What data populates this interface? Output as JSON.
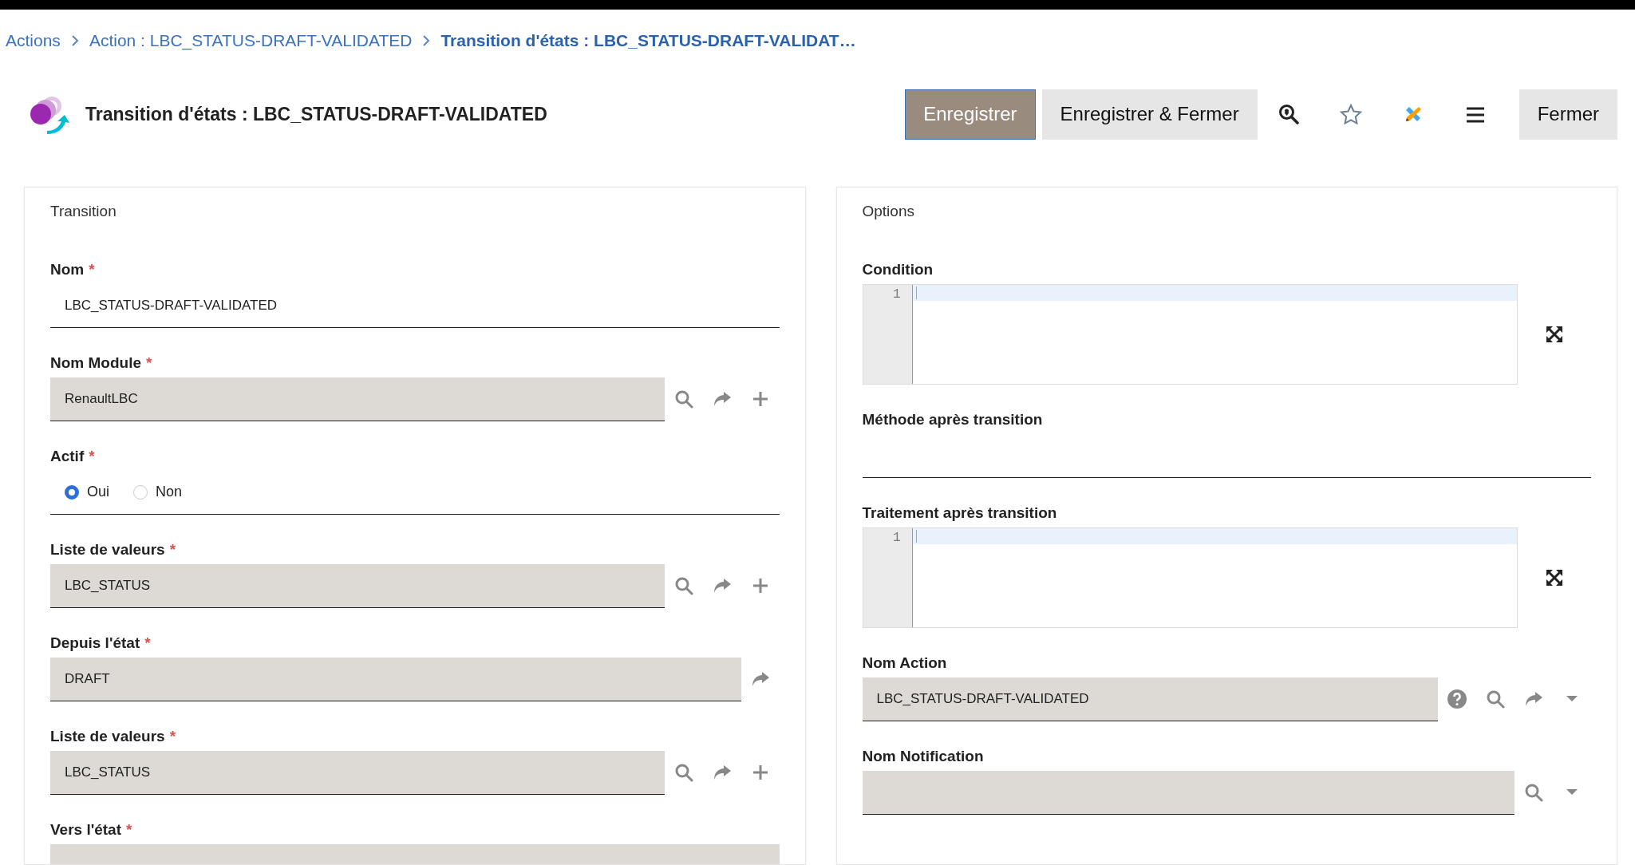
{
  "breadcrumb": [
    {
      "label": "Actions",
      "current": false
    },
    {
      "label": "Action : LBC_STATUS-DRAFT-VALIDATED",
      "current": false
    },
    {
      "label": "Transition d'états : LBC_STATUS-DRAFT-VALIDAT…",
      "current": true
    }
  ],
  "header": {
    "title": "Transition d'états : LBC_STATUS-DRAFT-VALIDATED",
    "buttons": [
      {
        "label": "Enregistrer",
        "kind": "primary"
      },
      {
        "label": "Enregistrer & Fermer",
        "kind": "secondary"
      }
    ],
    "tools": [
      {
        "kind": "locate"
      },
      {
        "kind": "star"
      },
      {
        "kind": "studio"
      },
      {
        "kind": "menu"
      }
    ],
    "close_button": "Fermer"
  },
  "panels": [
    {
      "title": "Transition",
      "fields": [
        {
          "kind": "text",
          "label": "Nom",
          "required_mark": "*",
          "value": "LBC_STATUS-DRAFT-VALIDATED"
        },
        {
          "kind": "select",
          "label": "Nom Module",
          "required_mark": "*",
          "value": "RenaultLBC",
          "actions": [
            {
              "kind": "search"
            },
            {
              "kind": "open"
            },
            {
              "kind": "add"
            }
          ]
        },
        {
          "kind": "radio",
          "label": "Actif",
          "required_mark": "*",
          "options": [
            {
              "label": "Oui",
              "selected": true
            },
            {
              "label": "Non",
              "selected": false
            }
          ]
        },
        {
          "kind": "select",
          "label": "Liste de valeurs",
          "required_mark": "*",
          "value": "LBC_STATUS",
          "actions": [
            {
              "kind": "search"
            },
            {
              "kind": "open"
            },
            {
              "kind": "add"
            }
          ]
        },
        {
          "kind": "select",
          "label": "Depuis l'état",
          "required_mark": "*",
          "value": "DRAFT",
          "actions": [
            {
              "kind": "open"
            }
          ]
        },
        {
          "kind": "select",
          "label": "Liste de valeurs",
          "required_mark": "*",
          "value": "LBC_STATUS",
          "actions": [
            {
              "kind": "search"
            },
            {
              "kind": "open"
            },
            {
              "kind": "add"
            }
          ]
        },
        {
          "kind": "select",
          "label": "Vers l'état",
          "required_mark": "*"
        }
      ]
    },
    {
      "title": "Options",
      "fields": [
        {
          "kind": "code",
          "label": "Condition",
          "line_numbers": [
            "1"
          ]
        },
        {
          "kind": "text",
          "label": "Méthode après transition"
        },
        {
          "kind": "code",
          "label": "Traitement après transition",
          "line_numbers": [
            "1"
          ]
        },
        {
          "kind": "select",
          "label": "Nom Action",
          "value": "LBC_STATUS-DRAFT-VALIDATED",
          "actions": [
            {
              "kind": "help"
            },
            {
              "kind": "search"
            },
            {
              "kind": "open"
            },
            {
              "kind": "dropdown"
            }
          ]
        },
        {
          "kind": "select",
          "label": "Nom Notification",
          "actions": [
            {
              "kind": "search"
            },
            {
              "kind": "dropdown"
            }
          ]
        }
      ]
    }
  ]
}
